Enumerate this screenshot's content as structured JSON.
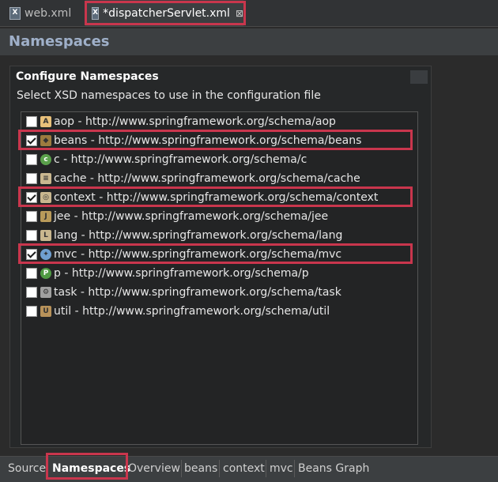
{
  "editor_tabs": [
    {
      "label": "web.xml",
      "icon": "xml-file-icon"
    },
    {
      "label": "*dispatcherServlet.xml",
      "icon": "xml-file-icon",
      "close": "⊠"
    }
  ],
  "page_title": "Namespaces",
  "section": {
    "title": "Configure Namespaces",
    "description": "Select XSD namespaces to use in the configuration file"
  },
  "namespaces": [
    {
      "label": "aop - http://www.springframework.org/schema/aop",
      "checked": false,
      "icon": "aop-icon"
    },
    {
      "label": "beans - http://www.springframework.org/schema/beans",
      "checked": true,
      "icon": "beans-icon"
    },
    {
      "label": "c - http://www.springframework.org/schema/c",
      "checked": false,
      "icon": "c-icon"
    },
    {
      "label": "cache - http://www.springframework.org/schema/cache",
      "checked": false,
      "icon": "cache-icon"
    },
    {
      "label": "context - http://www.springframework.org/schema/context",
      "checked": true,
      "icon": "context-icon"
    },
    {
      "label": "jee - http://www.springframework.org/schema/jee",
      "checked": false,
      "icon": "jee-icon"
    },
    {
      "label": "lang - http://www.springframework.org/schema/lang",
      "checked": false,
      "icon": "lang-icon"
    },
    {
      "label": "mvc - http://www.springframework.org/schema/mvc",
      "checked": true,
      "icon": "mvc-icon"
    },
    {
      "label": "p - http://www.springframework.org/schema/p",
      "checked": false,
      "icon": "p-icon"
    },
    {
      "label": "task - http://www.springframework.org/schema/task",
      "checked": false,
      "icon": "task-icon"
    },
    {
      "label": "util - http://www.springframework.org/schema/util",
      "checked": false,
      "icon": "util-icon"
    }
  ],
  "page_tabs": [
    "Source",
    "Namespaces",
    "Overview",
    "beans",
    "context",
    "mvc",
    "Beans Graph"
  ],
  "active_page_tab": "Namespaces",
  "colors": {
    "highlight": "#c9364d",
    "title": "#9fb0c9",
    "background": "#2b2b2b"
  }
}
